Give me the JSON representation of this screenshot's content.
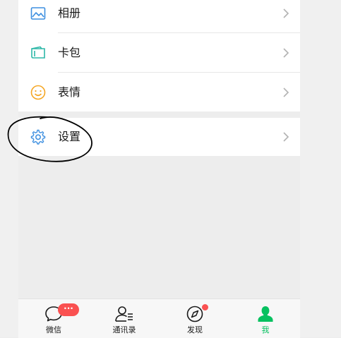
{
  "menu": {
    "items": [
      {
        "label": "相册",
        "icon": "album-icon"
      },
      {
        "label": "卡包",
        "icon": "card-wallet-icon"
      },
      {
        "label": "表情",
        "icon": "sticker-icon"
      }
    ],
    "settings": {
      "label": "设置",
      "icon": "gear-icon"
    }
  },
  "tabbar": {
    "tabs": [
      {
        "label": "微信",
        "icon": "chat-icon",
        "badge": "···"
      },
      {
        "label": "通讯录",
        "icon": "contacts-icon"
      },
      {
        "label": "发现",
        "icon": "compass-icon"
      },
      {
        "label": "我",
        "icon": "me-icon",
        "active": true
      }
    ]
  },
  "colors": {
    "accent_green": "#07c160",
    "badge_red": "#fa5151",
    "icon_blue": "#3d8fe0",
    "icon_orange": "#f5a623"
  }
}
